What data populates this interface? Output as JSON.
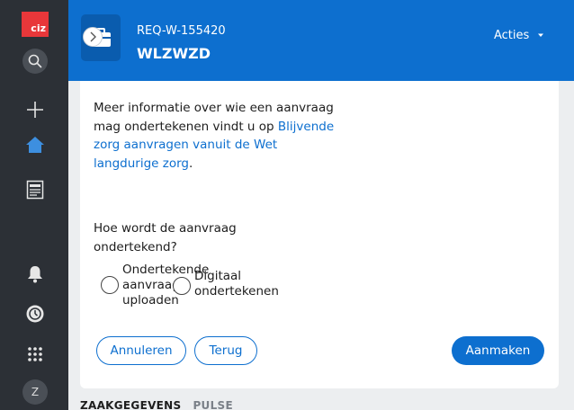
{
  "brand": {
    "logo_text": "ciz",
    "logo_color": "#e8373a"
  },
  "sidebar": {
    "icons": [
      "search-icon",
      "plus-icon",
      "home-icon",
      "document-icon",
      "bell-icon",
      "history-icon",
      "apps-grid-icon"
    ],
    "avatar_initial": "Z"
  },
  "header": {
    "case_id": "REQ-W-155420",
    "case_title": "WLZWZD",
    "actions_label": "Acties"
  },
  "form": {
    "info_prefix": "Meer informatie over wie een aanvraag mag ondertekenen vindt u op ",
    "info_link": "Blijvende zorg aanvragen vanuit de Wet langdurige zorg",
    "info_suffix": ".",
    "question": "Hoe wordt de aanvraag ondertekend?",
    "options": [
      {
        "label": "Ondertekende aanvraag uploaden",
        "selected": false
      },
      {
        "label": "Digitaal ondertekenen",
        "selected": false
      }
    ]
  },
  "buttons": {
    "cancel": "Annuleren",
    "back": "Terug",
    "create": "Aanmaken"
  },
  "tabs": [
    {
      "label": "ZAAKGEGEVENS",
      "active": true
    },
    {
      "label": "PULSE",
      "active": false
    }
  ],
  "colors": {
    "primary": "#0d6fcf",
    "sidebar": "#2c3036",
    "link": "#0d6fcf"
  }
}
